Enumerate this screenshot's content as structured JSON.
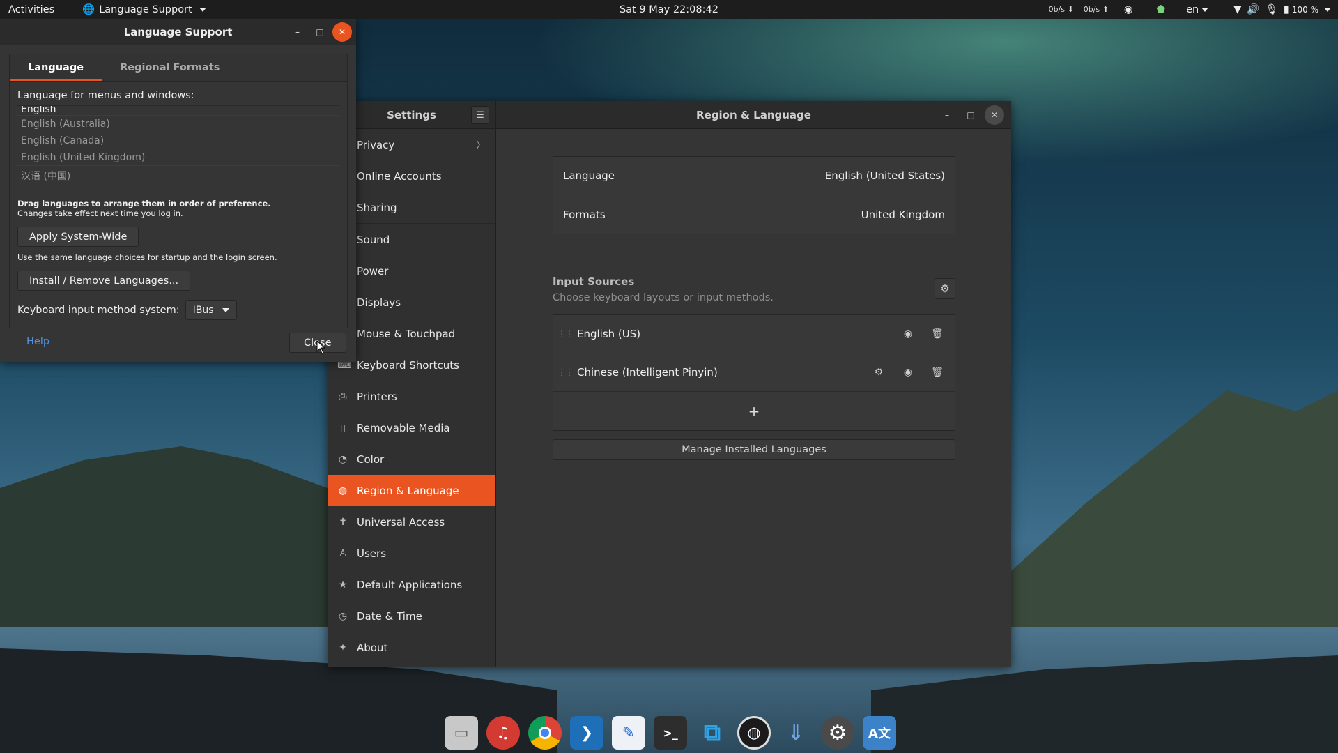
{
  "topbar": {
    "activities": "Activities",
    "app_menu": "Language Support",
    "clock": "Sat 9 May  22:08:42",
    "net_down": "0b/s",
    "net_up": "0b/s",
    "input_lang": "en",
    "battery": "100 %"
  },
  "lang_window": {
    "title": "Language Support",
    "tabs": [
      "Language",
      "Regional Formats"
    ],
    "menus_label": "Language for menus and windows:",
    "languages": [
      "English",
      "English (Australia)",
      "English (Canada)",
      "English (United Kingdom)",
      "汉语 (中国)"
    ],
    "drag_hint": "Drag languages to arrange them in order of preference.",
    "logout_hint": "Changes take effect next time you log in.",
    "apply_button": "Apply System-Wide",
    "same_hint": "Use the same language choices for startup and the login screen.",
    "install_button": "Install / Remove Languages...",
    "kb_label": "Keyboard input method system:",
    "kb_value": "IBus",
    "help": "Help",
    "close": "Close"
  },
  "settings": {
    "sidebar_title": "Settings",
    "main_title": "Region & Language",
    "sidebar_items": [
      {
        "label": "Privacy",
        "icon": "hand-icon"
      },
      {
        "label": "Online Accounts",
        "icon": "cloud-icon"
      },
      {
        "label": "Sharing",
        "icon": "share-icon"
      },
      {
        "label": "Sound",
        "icon": "speaker-icon"
      },
      {
        "label": "Power",
        "icon": "battery-icon"
      },
      {
        "label": "Displays",
        "icon": "display-icon"
      },
      {
        "label": "Mouse & Touchpad",
        "icon": "mouse-icon"
      },
      {
        "label": "Keyboard Shortcuts",
        "icon": "keyboard-icon"
      },
      {
        "label": "Printers",
        "icon": "printer-icon"
      },
      {
        "label": "Removable Media",
        "icon": "usb-icon"
      },
      {
        "label": "Color",
        "icon": "palette-icon"
      },
      {
        "label": "Region & Language",
        "icon": "globe-icon"
      },
      {
        "label": "Universal Access",
        "icon": "accessibility-icon"
      },
      {
        "label": "Users",
        "icon": "user-icon"
      },
      {
        "label": "Default Applications",
        "icon": "star-icon"
      },
      {
        "label": "Date & Time",
        "icon": "clock-icon"
      },
      {
        "label": "About",
        "icon": "sparkle-icon"
      }
    ],
    "language_label": "Language",
    "language_value": "English (United States)",
    "formats_label": "Formats",
    "formats_value": "United Kingdom",
    "input_title": "Input Sources",
    "input_sub": "Choose keyboard layouts or input methods.",
    "sources": [
      "English (US)",
      "Chinese (Intelligent Pinyin)"
    ],
    "add_symbol": "+",
    "manage_button": "Manage Installed Languages"
  },
  "colors": {
    "accent": "#e95420",
    "link": "#5294e2"
  }
}
